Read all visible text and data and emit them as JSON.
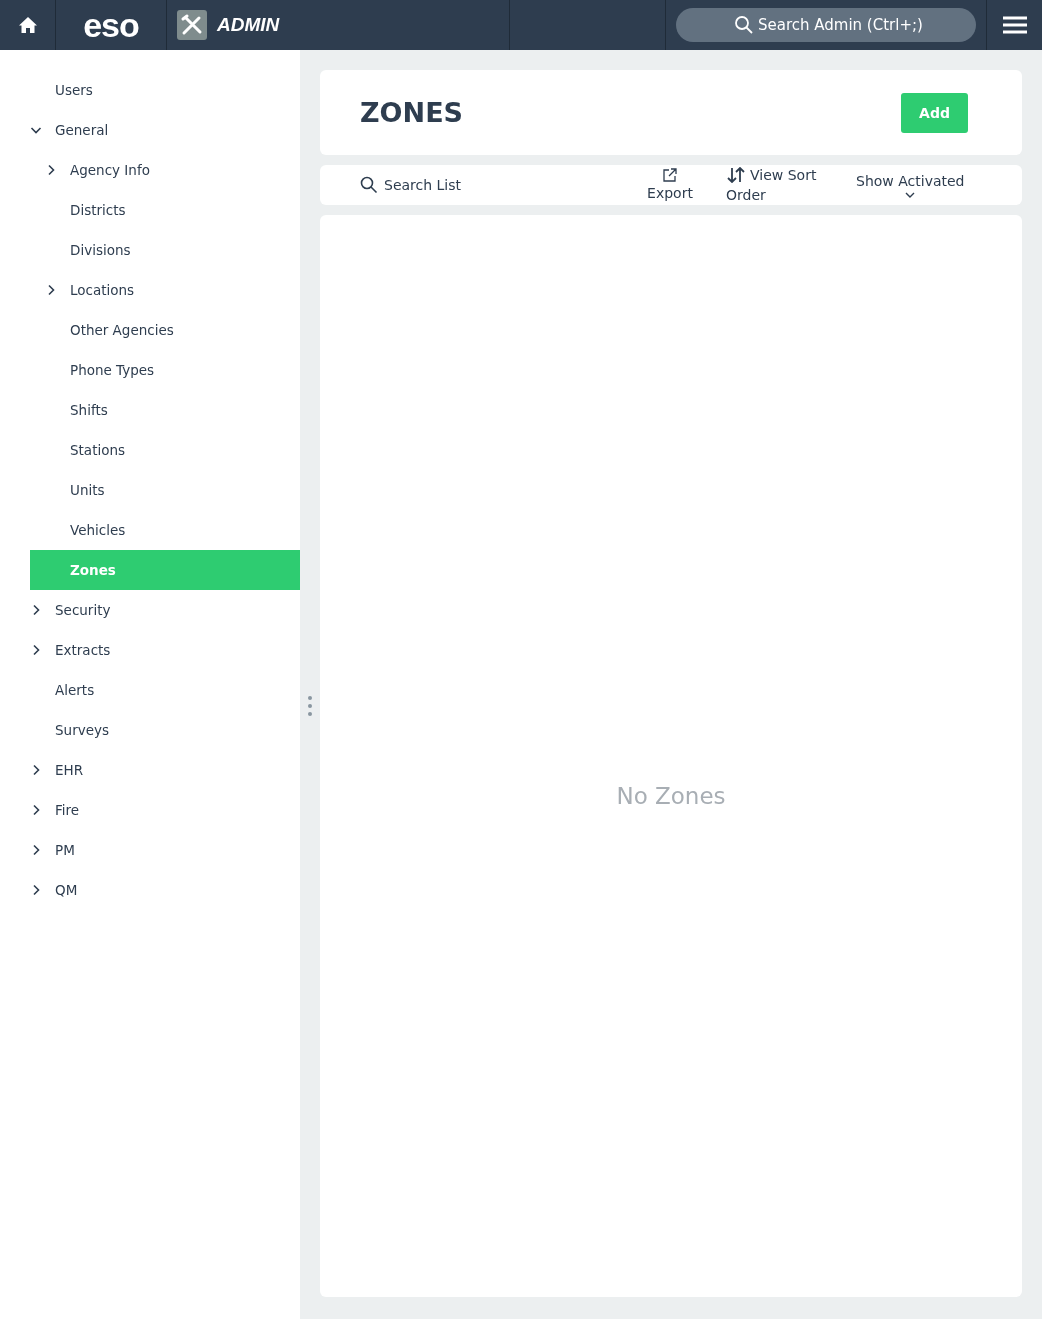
{
  "header": {
    "brand": "eso",
    "section": "ADMIN",
    "search": {
      "placeholder": "Search Admin (Ctrl+;)"
    }
  },
  "sidebar": {
    "items": [
      {
        "label": "Users",
        "selected": false
      },
      {
        "label": "General",
        "selected": false,
        "expanded": true,
        "children": [
          {
            "label": "Agency Info",
            "selected": false,
            "expanded": false
          },
          {
            "label": "Districts",
            "selected": false
          },
          {
            "label": "Divisions",
            "selected": false
          },
          {
            "label": "Locations",
            "selected": false,
            "expanded": false
          },
          {
            "label": "Other Agencies",
            "selected": false
          },
          {
            "label": "Phone Types",
            "selected": false
          },
          {
            "label": "Shifts",
            "selected": false
          },
          {
            "label": "Stations",
            "selected": false
          },
          {
            "label": "Units",
            "selected": false
          },
          {
            "label": "Vehicles",
            "selected": false
          },
          {
            "label": "Zones",
            "selected": true
          }
        ]
      },
      {
        "label": "Security",
        "selected": false,
        "expanded": false
      },
      {
        "label": "Extracts",
        "selected": false,
        "expanded": false
      },
      {
        "label": "Alerts",
        "selected": false
      },
      {
        "label": "Surveys",
        "selected": false
      },
      {
        "label": "EHR",
        "selected": false,
        "expanded": false
      },
      {
        "label": "Fire",
        "selected": false,
        "expanded": false
      },
      {
        "label": "PM",
        "selected": false,
        "expanded": false
      },
      {
        "label": "QM",
        "selected": false,
        "expanded": false
      }
    ]
  },
  "page": {
    "title": "ZONES",
    "add_button": "Add"
  },
  "toolbar": {
    "search": {
      "placeholder": "Search List"
    },
    "export": "Export",
    "sort": "View Sort Order",
    "filter": "Show Activated"
  },
  "list": {
    "empty_message": "No Zones"
  }
}
